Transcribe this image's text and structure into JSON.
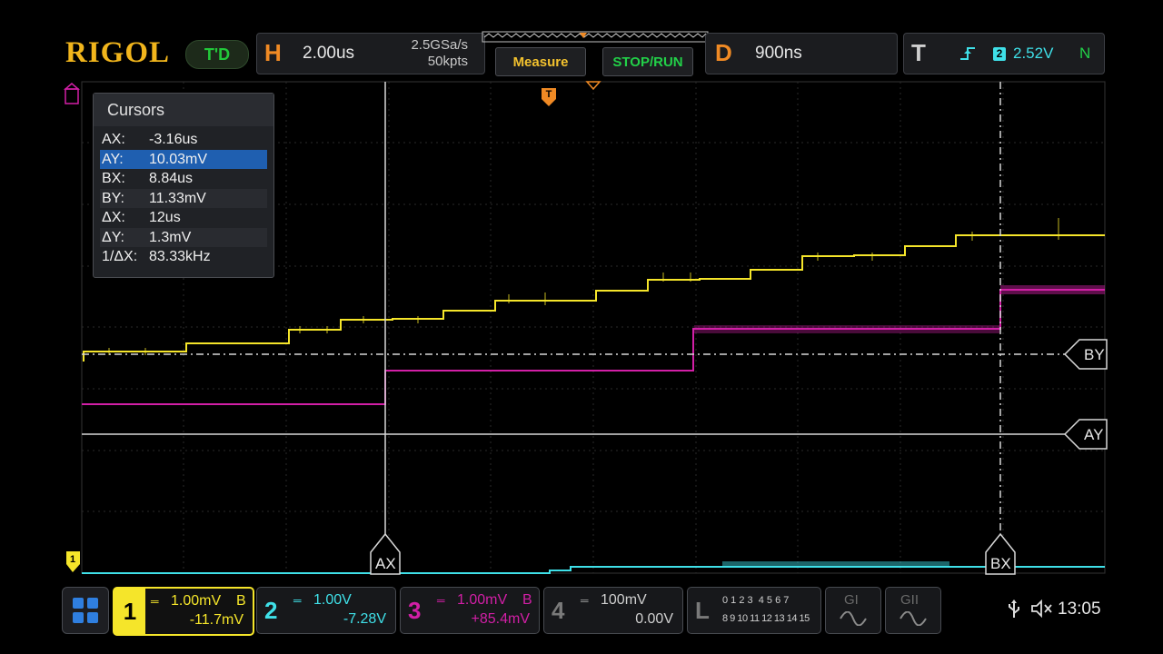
{
  "brand": {
    "logo": "RIGOL",
    "badge": "T'D"
  },
  "horizontal": {
    "letter": "H",
    "timebase": "2.00us",
    "sample_rate": "2.5GSa/s",
    "memory": "50kpts"
  },
  "buttons": {
    "measure": "Measure",
    "stop_run": "STOP/RUN"
  },
  "delay": {
    "letter": "D",
    "value": "900ns"
  },
  "trigger": {
    "letter": "T",
    "source": "2",
    "level": "2.52V",
    "mode": "N"
  },
  "cursors_panel": {
    "title": "Cursors",
    "rows": [
      {
        "k": "AX:",
        "v": "-3.16us"
      },
      {
        "k": "AY:",
        "v": "10.03mV"
      },
      {
        "k": "BX:",
        "v": "8.84us"
      },
      {
        "k": "BY:",
        "v": "11.33mV"
      },
      {
        "k": "ΔX:",
        "v": "12us"
      },
      {
        "k": "ΔY:",
        "v": "1.3mV"
      },
      {
        "k": "1/ΔX:",
        "v": "83.33kHz"
      }
    ],
    "selected_index": 1
  },
  "cursor_tags": {
    "ax": "AX",
    "bx": "BX",
    "ay": "AY",
    "by": "BY"
  },
  "channels": [
    {
      "num": "1",
      "scale": "1.00mV",
      "bw": "B",
      "offset": "-11.7mV",
      "color": "#f5e52a"
    },
    {
      "num": "2",
      "scale": "1.00V",
      "bw": "",
      "offset": "-7.28V",
      "color": "#3fe0e8"
    },
    {
      "num": "3",
      "scale": "1.00mV",
      "bw": "B",
      "offset": "+85.4mV",
      "color": "#d21fa6"
    },
    {
      "num": "4",
      "scale": "100mV",
      "bw": "",
      "offset": "0.00V",
      "color": "#7a7a7a"
    }
  ],
  "logic": {
    "letter": "L",
    "row1": "0 1 2 3  4 5 6 7",
    "row2": "8 9 10 11 12 13 14 15"
  },
  "generators": {
    "g1": "GI",
    "g2": "GII"
  },
  "status": {
    "time": "13:05"
  },
  "colors": {
    "ch1": "#f5e52a",
    "ch2": "#3fe0e8",
    "ch3": "#d21fa6",
    "accent": "#f08a24",
    "grid": "#3a3a3a"
  }
}
